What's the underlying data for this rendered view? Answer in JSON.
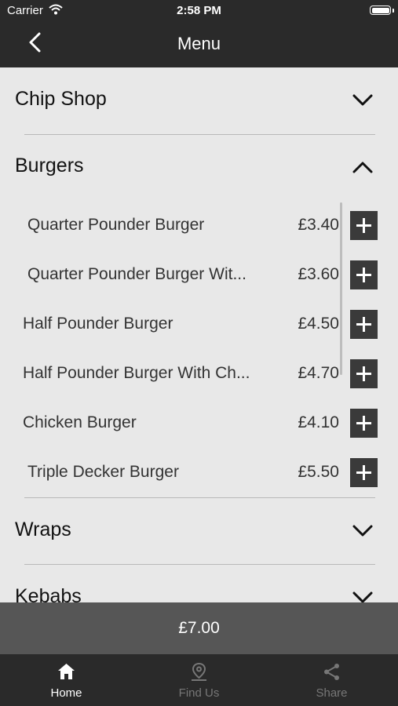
{
  "status_bar": {
    "carrier": "Carrier",
    "time": "2:58 PM"
  },
  "header": {
    "title": "Menu"
  },
  "categories": [
    {
      "label": "Chip Shop",
      "expanded": false
    },
    {
      "label": "Burgers",
      "expanded": true
    },
    {
      "label": "Wraps",
      "expanded": false
    },
    {
      "label": "Kebabs",
      "expanded": false
    }
  ],
  "burgers": [
    {
      "name": "Quarter Pounder Burger",
      "price": "£3.40"
    },
    {
      "name": "Quarter Pounder Burger Wit...",
      "price": "£3.60"
    },
    {
      "name": "Half Pounder Burger",
      "price": "£4.50"
    },
    {
      "name": "Half Pounder Burger With Ch...",
      "price": "£4.70"
    },
    {
      "name": "Chicken Burger",
      "price": "£4.10"
    },
    {
      "name": "Triple Decker Burger",
      "price": "£5.50"
    }
  ],
  "basket": {
    "total": "£7.00"
  },
  "tabs": [
    {
      "label": "Home",
      "icon": "home-icon",
      "active": true
    },
    {
      "label": "Find Us",
      "icon": "location-pin-icon",
      "active": false
    },
    {
      "label": "Share",
      "icon": "share-icon",
      "active": false
    }
  ],
  "colors": {
    "header_bg": "#2a2a2a",
    "content_bg": "#e8e8e8",
    "add_button": "#3a3a3a",
    "total_bar": "#565656"
  }
}
